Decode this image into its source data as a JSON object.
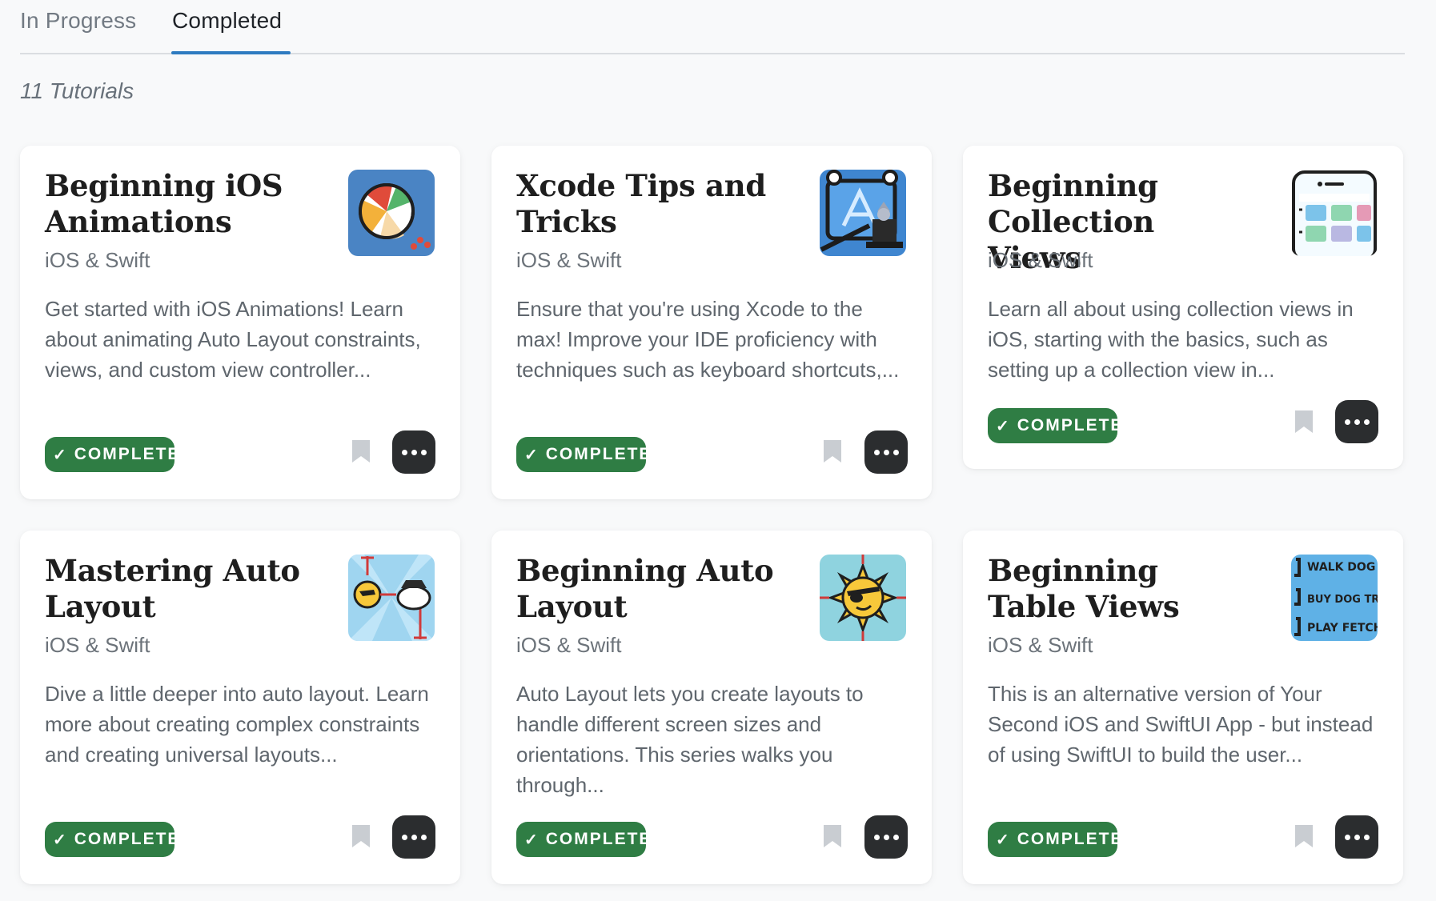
{
  "tabs": [
    {
      "label": "In Progress",
      "active": false
    },
    {
      "label": "Completed",
      "active": true
    }
  ],
  "count_text": "11 Tutorials",
  "colors": {
    "accent": "#2e7bc0",
    "complete_badge": "#2f7d44",
    "more_button": "#2b2d2f"
  },
  "cards": [
    {
      "title": "Beginning iOS Animations",
      "subtitle": "iOS & Swift",
      "description": "Get started with iOS Animations! Learn about animating Auto Layout constraints, views, and custom view controller...",
      "badge": "COMPLETE",
      "thumb_icon": "beach-ball-icon",
      "bookmark_icon": "bookmark-icon",
      "more_icon": "more-dots-icon"
    },
    {
      "title": "Xcode Tips and Tricks",
      "subtitle": "iOS & Swift",
      "description": "Ensure that you're using Xcode to the max! Improve your IDE proficiency with techniques such as keyboard shortcuts,...",
      "badge": "COMPLETE",
      "thumb_icon": "xcode-magic-hat-icon",
      "bookmark_icon": "bookmark-icon",
      "more_icon": "more-dots-icon"
    },
    {
      "title": "Beginning Collection Views",
      "subtitle": "iOS & Swift",
      "description": "Learn all about using collection views in iOS, starting with the basics, such as setting up a collection view in...",
      "badge": "COMPLETE",
      "thumb_icon": "phone-grid-icon",
      "bookmark_icon": "bookmark-icon",
      "more_icon": "more-dots-icon"
    },
    {
      "title": "Mastering Auto Layout",
      "subtitle": "iOS & Swift",
      "description": "Dive a little deeper into auto layout. Learn more about creating complex constraints and creating universal layouts...",
      "badge": "COMPLETE",
      "thumb_icon": "sun-pirate-icon",
      "bookmark_icon": "bookmark-icon",
      "more_icon": "more-dots-icon"
    },
    {
      "title": "Beginning Auto Layout",
      "subtitle": "iOS & Swift",
      "description": "Auto Layout lets you create layouts to handle different screen sizes and orientations. This series walks you through...",
      "badge": "COMPLETE",
      "thumb_icon": "sun-eyepatch-icon",
      "bookmark_icon": "bookmark-icon",
      "more_icon": "more-dots-icon"
    },
    {
      "title": "Beginning Table Views",
      "subtitle": "iOS & Swift",
      "description": "This is an alternative version of Your Second iOS and SwiftUI App - but instead of using SwiftUI to build the user...",
      "badge": "COMPLETE",
      "thumb_icon": "todo-list-icon",
      "thumb_lines": [
        "WALK DOG",
        "BUY DOG TREA",
        "PLAY FETCH"
      ],
      "bookmark_icon": "bookmark-icon",
      "more_icon": "more-dots-icon"
    }
  ]
}
